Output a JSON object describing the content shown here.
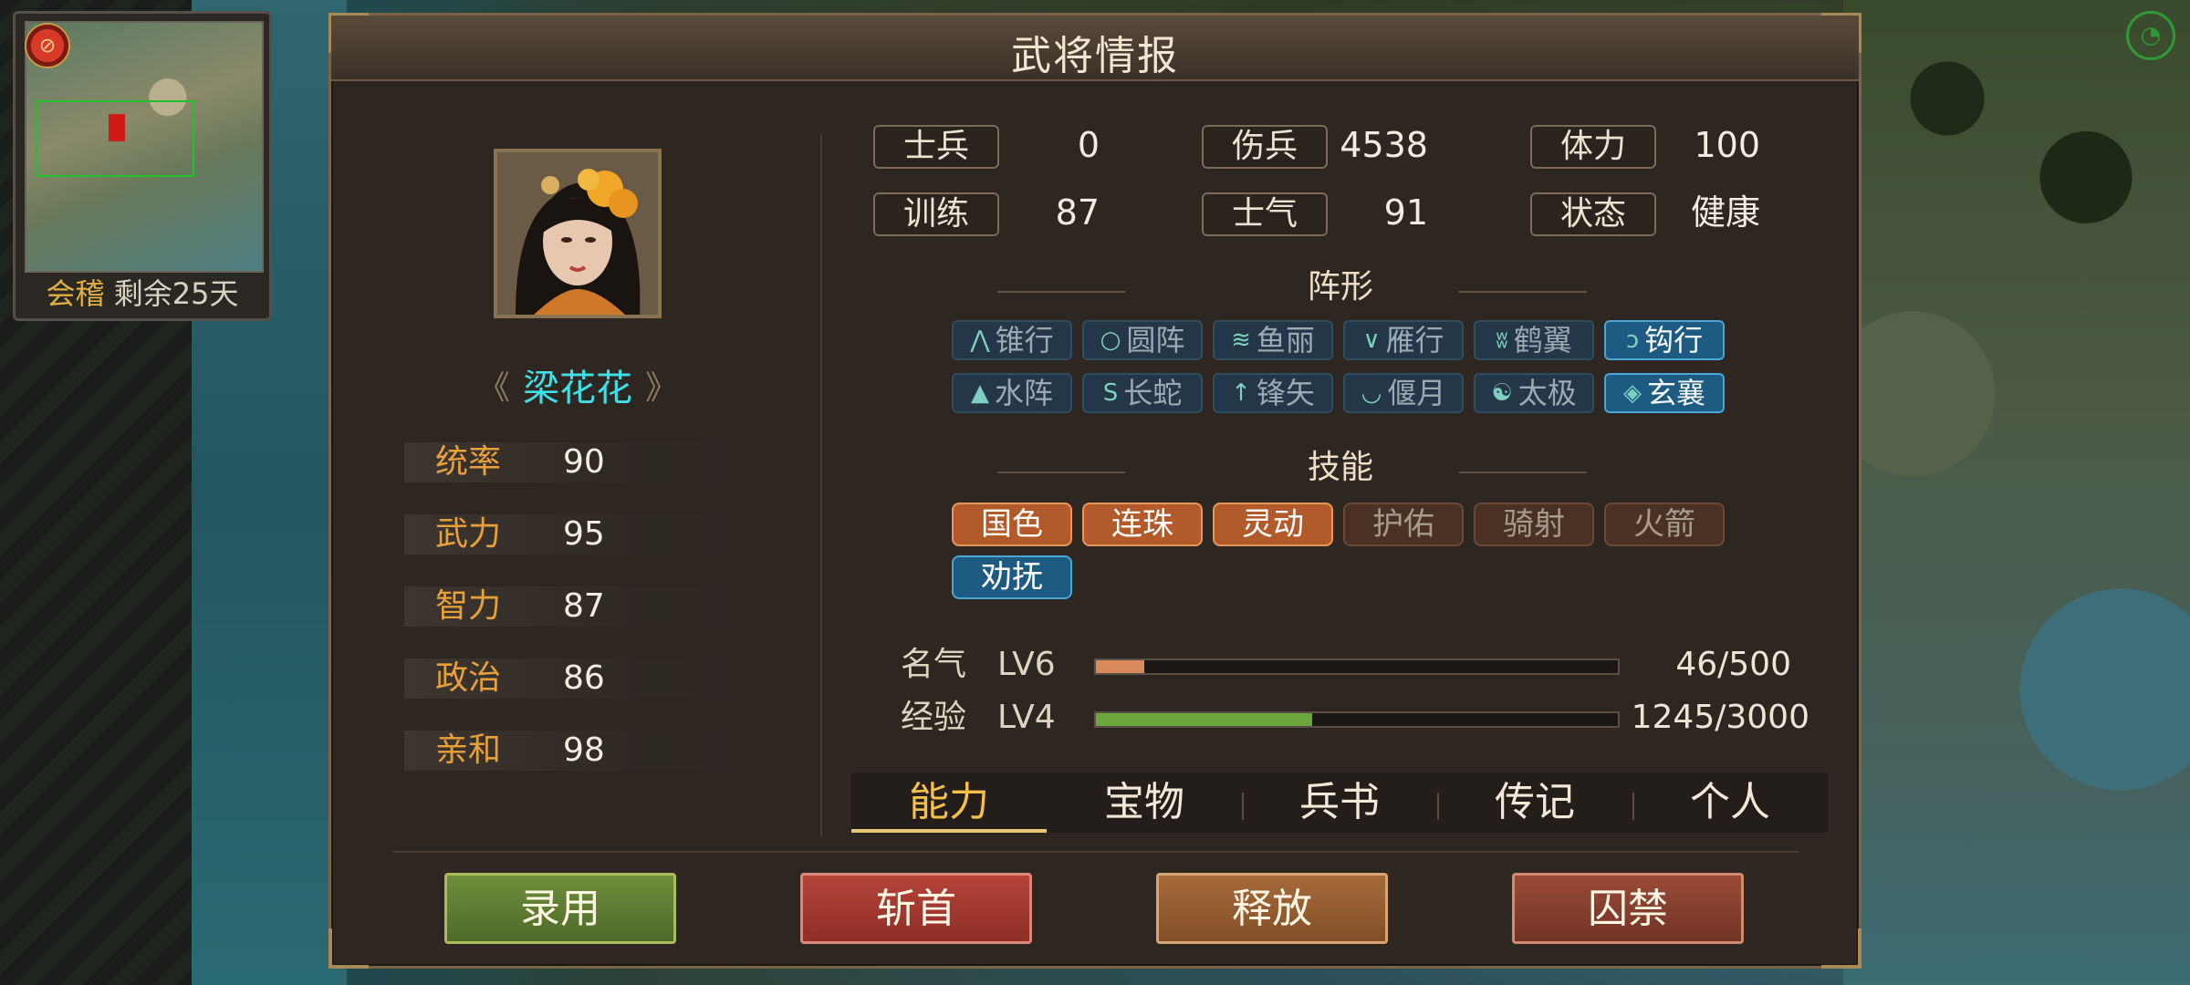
{
  "minimap": {
    "city": "会稽",
    "remaining": "剩余25天"
  },
  "panel": {
    "title": "武将情报"
  },
  "general": {
    "name": "梁花花"
  },
  "stats": [
    {
      "label": "统率",
      "value": "90"
    },
    {
      "label": "武力",
      "value": "95"
    },
    {
      "label": "智力",
      "value": "87"
    },
    {
      "label": "政治",
      "value": "86"
    },
    {
      "label": "亲和",
      "value": "98"
    }
  ],
  "info": {
    "soldiers": {
      "label": "士兵",
      "value": "0"
    },
    "wounded": {
      "label": "伤兵",
      "value": "4538"
    },
    "stamina": {
      "label": "体力",
      "value": "100"
    },
    "training": {
      "label": "训练",
      "value": "87"
    },
    "morale": {
      "label": "士气",
      "value": "91"
    },
    "status": {
      "label": "状态",
      "value": "健康"
    }
  },
  "formation_section": {
    "title": "阵形"
  },
  "formations": [
    {
      "icon": "⋀",
      "label": "锥行",
      "active": false
    },
    {
      "icon": "○",
      "label": "圆阵",
      "active": false
    },
    {
      "icon": "≋",
      "label": "鱼丽",
      "active": false
    },
    {
      "icon": "∨",
      "label": "雁行",
      "active": false
    },
    {
      "icon": "ʬ",
      "label": "鹤翼",
      "active": false
    },
    {
      "icon": "ↄ",
      "label": "钩行",
      "active": true
    },
    {
      "icon": "▲",
      "label": "水阵",
      "active": false
    },
    {
      "icon": "S",
      "label": "长蛇",
      "active": false
    },
    {
      "icon": "↑",
      "label": "锋矢",
      "active": false
    },
    {
      "icon": "◡",
      "label": "偃月",
      "active": false
    },
    {
      "icon": "☯",
      "label": "太极",
      "active": false
    },
    {
      "icon": "◈",
      "label": "玄襄",
      "active": true
    }
  ],
  "skill_section": {
    "title": "技能"
  },
  "skills": [
    {
      "label": "国色",
      "state": "owned"
    },
    {
      "label": "连珠",
      "state": "owned"
    },
    {
      "label": "灵动",
      "state": "owned"
    },
    {
      "label": "护佑",
      "state": "locked"
    },
    {
      "label": "骑射",
      "state": "locked"
    },
    {
      "label": "火箭",
      "state": "locked"
    },
    {
      "label": "劝抚",
      "state": "blue"
    }
  ],
  "fame": {
    "label": "名气",
    "level": "LV6",
    "current": 46,
    "max": 500,
    "text": "46/500",
    "color": "#d98a5a"
  },
  "exp": {
    "label": "经验",
    "level": "LV4",
    "current": 1245,
    "max": 3000,
    "text": "1245/3000",
    "color": "#6aa63c"
  },
  "tabs": [
    "能力",
    "宝物",
    "兵书",
    "传记",
    "个人"
  ],
  "actions": {
    "hire": "录用",
    "behead": "斩首",
    "release": "释放",
    "imprison": "囚禁"
  }
}
